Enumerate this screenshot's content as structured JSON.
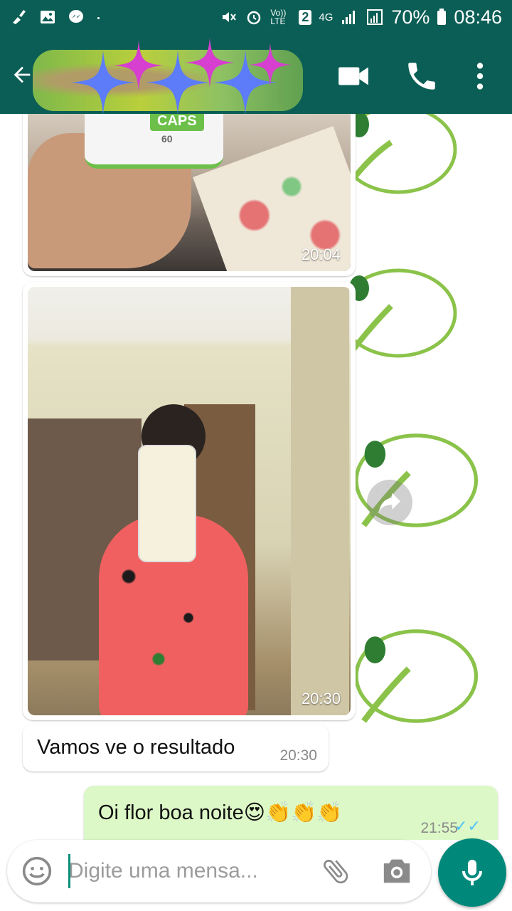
{
  "status": {
    "battery": "70%",
    "time": "08:46",
    "network": "4G",
    "sim_slot": "2",
    "volte": "Vo)) LTE"
  },
  "header": {
    "contact_name_redacted": true,
    "icons": [
      "back-arrow-icon",
      "video-call-icon",
      "phone-call-icon",
      "more-vert-icon"
    ]
  },
  "messages": [
    {
      "type": "image",
      "direction": "incoming",
      "time": "20:04",
      "product_label": "CAPS",
      "caps_count": "60"
    },
    {
      "type": "image",
      "direction": "incoming",
      "time": "20:30"
    },
    {
      "type": "text",
      "direction": "incoming",
      "text": "Vamos ve o resultado",
      "time": "20:30"
    },
    {
      "type": "text",
      "direction": "outgoing",
      "text": "Oi flor boa noite😍👏👏👏",
      "time": "21:55",
      "status": "read"
    }
  ],
  "input": {
    "placeholder": "Digite uma mensa..."
  },
  "colors": {
    "header": "#0b5e55",
    "outgoing_bubble": "#dcf8c6",
    "mic_button": "#00897b",
    "read_ticks": "#4fc3f7",
    "watermark": "#8bc34a"
  }
}
